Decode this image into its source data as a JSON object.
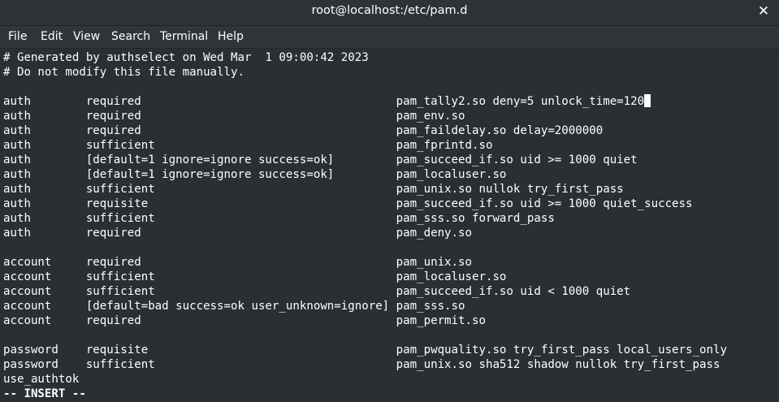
{
  "window": {
    "title": "root@localhost:/etc/pam.d",
    "close_glyph": "✕"
  },
  "menu": [
    "File",
    "Edit",
    "View",
    "Search",
    "Terminal",
    "Help"
  ],
  "lines": [
    "# Generated by authselect on Wed Mar  1 09:00:42 2023",
    "# Do not modify this file manually.",
    "",
    "auth        required                                     pam_tally2.so deny=5 unlock_time=120",
    "auth        required                                     pam_env.so",
    "auth        required                                     pam_faildelay.so delay=2000000",
    "auth        sufficient                                   pam_fprintd.so",
    "auth        [default=1 ignore=ignore success=ok]         pam_succeed_if.so uid >= 1000 quiet",
    "auth        [default=1 ignore=ignore success=ok]         pam_localuser.so",
    "auth        sufficient                                   pam_unix.so nullok try_first_pass",
    "auth        requisite                                    pam_succeed_if.so uid >= 1000 quiet_success",
    "auth        sufficient                                   pam_sss.so forward_pass",
    "auth        required                                     pam_deny.so",
    "",
    "account     required                                     pam_unix.so",
    "account     sufficient                                   pam_localuser.so",
    "account     sufficient                                   pam_succeed_if.so uid < 1000 quiet",
    "account     [default=bad success=ok user_unknown=ignore] pam_sss.so",
    "account     required                                     pam_permit.so",
    "",
    "password    requisite                                    pam_pwquality.so try_first_pass local_users_only",
    "password    sufficient                                   pam_unix.so sha512 shadow nullok try_first_pass",
    "use_authtok"
  ],
  "mode_line": "-- INSERT --"
}
